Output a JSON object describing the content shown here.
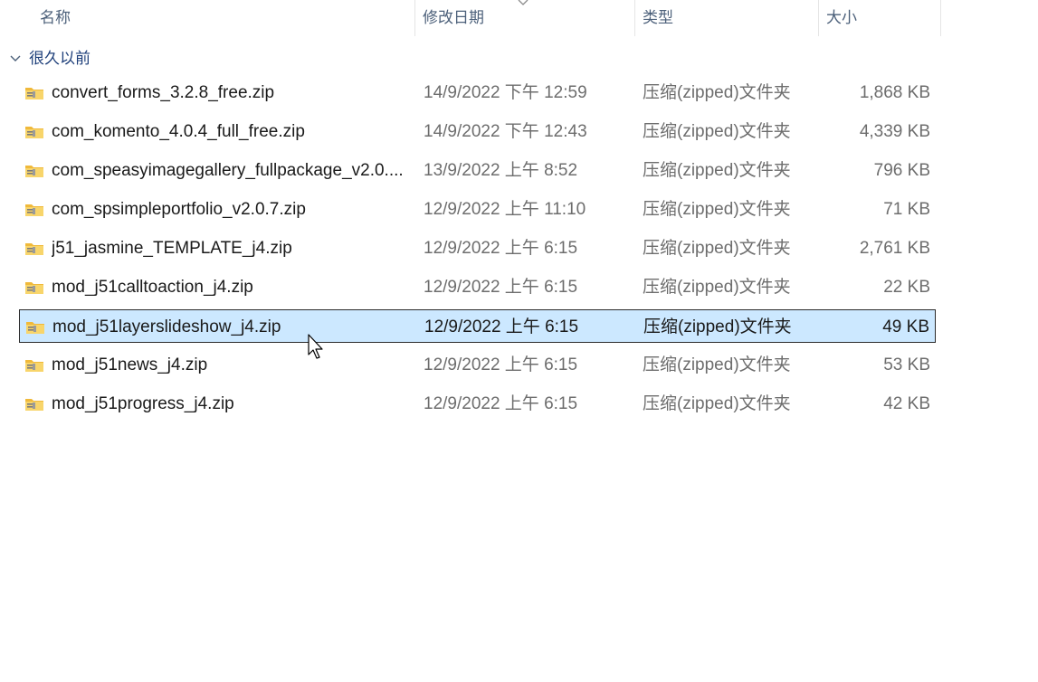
{
  "columns": {
    "name": "名称",
    "date": "修改日期",
    "type": "类型",
    "size": "大小"
  },
  "group": {
    "label": "很久以前"
  },
  "files": [
    {
      "name": "convert_forms_3.2.8_free.zip",
      "date": "14/9/2022 下午 12:59",
      "type": "压缩(zipped)文件夹",
      "size": "1,868 KB",
      "selected": false
    },
    {
      "name": "com_komento_4.0.4_full_free.zip",
      "date": "14/9/2022 下午 12:43",
      "type": "压缩(zipped)文件夹",
      "size": "4,339 KB",
      "selected": false
    },
    {
      "name": "com_speasyimagegallery_fullpackage_v2.0....",
      "date": "13/9/2022 上午 8:52",
      "type": "压缩(zipped)文件夹",
      "size": "796 KB",
      "selected": false
    },
    {
      "name": "com_spsimpleportfolio_v2.0.7.zip",
      "date": "12/9/2022 上午 11:10",
      "type": "压缩(zipped)文件夹",
      "size": "71 KB",
      "selected": false
    },
    {
      "name": "j51_jasmine_TEMPLATE_j4.zip",
      "date": "12/9/2022 上午 6:15",
      "type": "压缩(zipped)文件夹",
      "size": "2,761 KB",
      "selected": false
    },
    {
      "name": "mod_j51calltoaction_j4.zip",
      "date": "12/9/2022 上午 6:15",
      "type": "压缩(zipped)文件夹",
      "size": "22 KB",
      "selected": false
    },
    {
      "name": "mod_j51layerslideshow_j4.zip",
      "date": "12/9/2022 上午 6:15",
      "type": "压缩(zipped)文件夹",
      "size": "49 KB",
      "selected": true
    },
    {
      "name": "mod_j51news_j4.zip",
      "date": "12/9/2022 上午 6:15",
      "type": "压缩(zipped)文件夹",
      "size": "53 KB",
      "selected": false
    },
    {
      "name": "mod_j51progress_j4.zip",
      "date": "12/9/2022 上午 6:15",
      "type": "压缩(zipped)文件夹",
      "size": "42 KB",
      "selected": false
    }
  ],
  "icons": {
    "file": "zip-folder-icon",
    "group_toggle": "chevron-down-icon",
    "sort": "sort-indicator-icon"
  },
  "colors": {
    "selection_bg": "#cce8ff",
    "header_text": "#4c607a",
    "group_text": "#1e3f7a",
    "folder_yellow": "#f5c842"
  }
}
